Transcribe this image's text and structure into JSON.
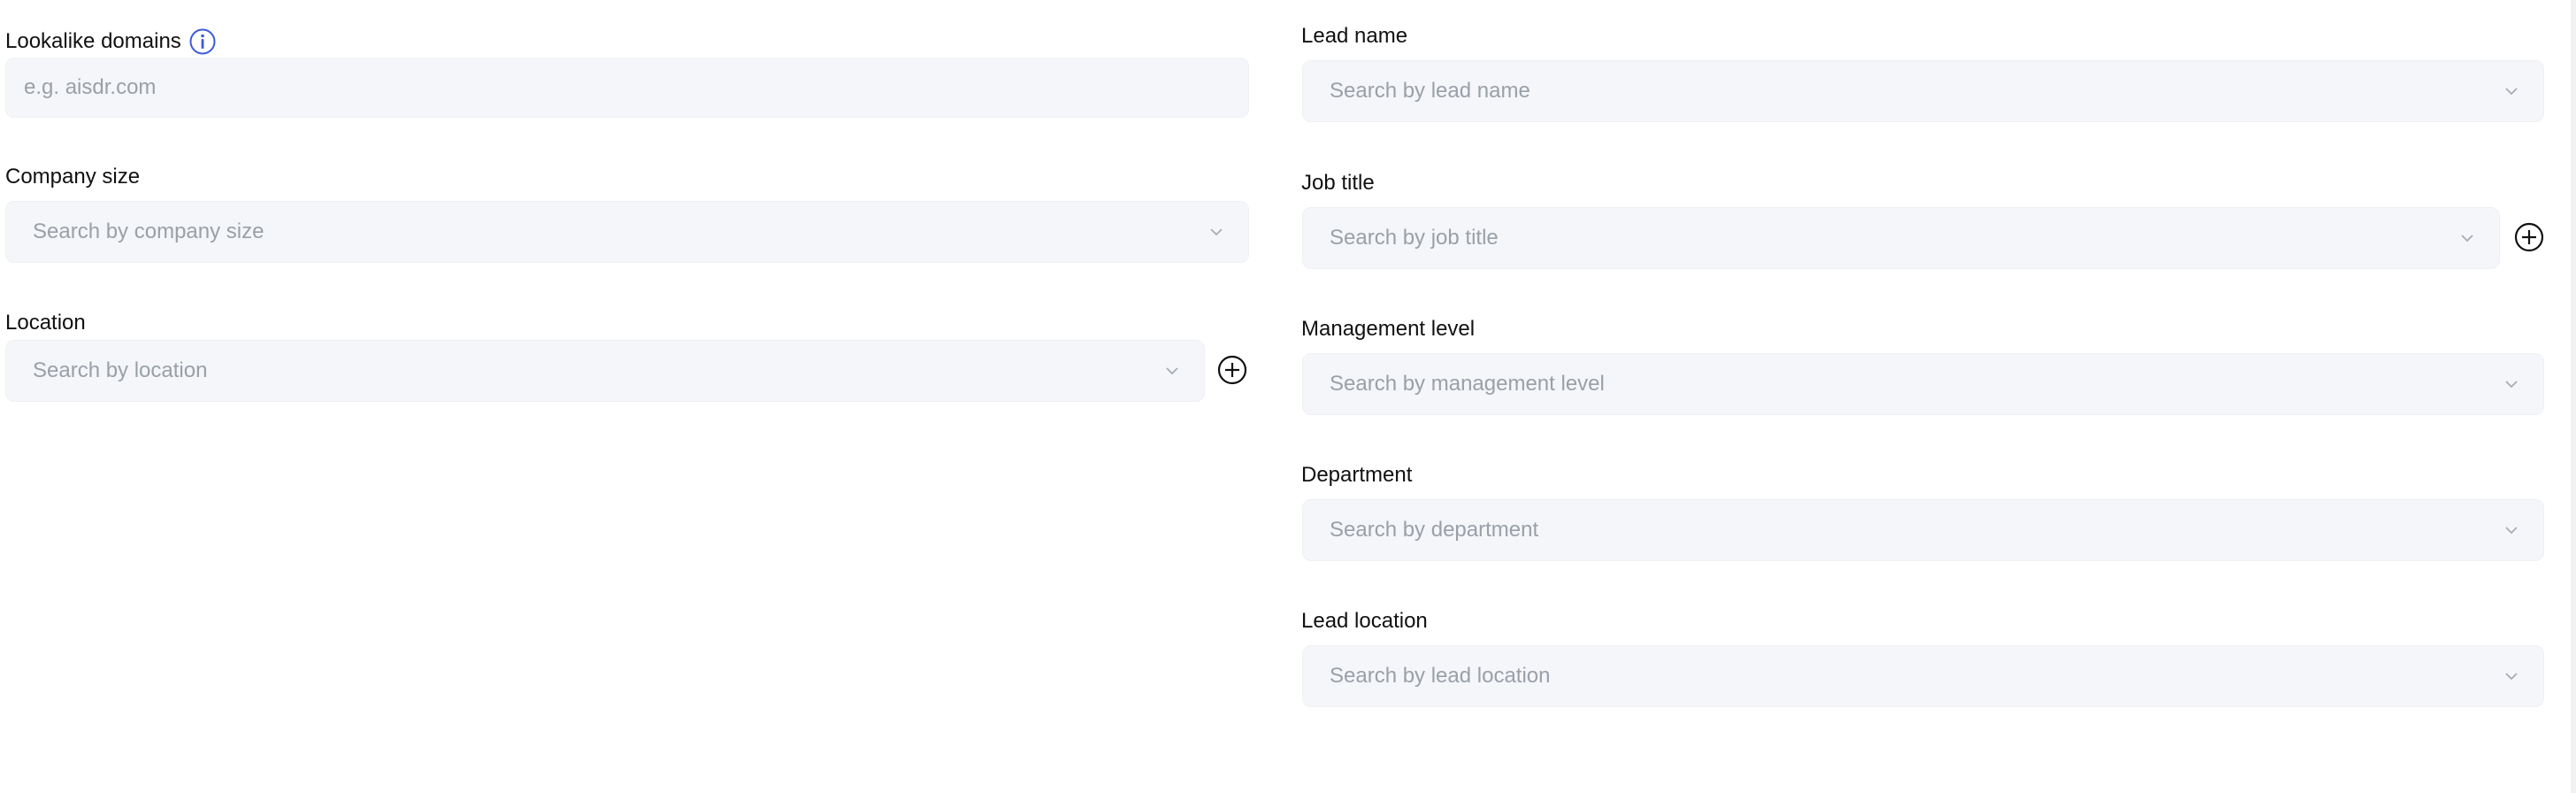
{
  "left_column": {
    "lookalike_domains": {
      "label": "Lookalike domains",
      "placeholder": "e.g. aisdr.com",
      "value": ""
    },
    "company_size": {
      "label": "Company size",
      "placeholder": "Search by company size"
    },
    "location": {
      "label": "Location",
      "placeholder": "Search by location"
    }
  },
  "right_column": {
    "lead_name": {
      "label": "Lead name",
      "placeholder": "Search by lead name"
    },
    "job_title": {
      "label": "Job title",
      "placeholder": "Search by job title"
    },
    "management_level": {
      "label": "Management level",
      "placeholder": "Search by management level"
    },
    "department": {
      "label": "Department",
      "placeholder": "Search by department"
    },
    "lead_location": {
      "label": "Lead location",
      "placeholder": "Search by lead location"
    }
  },
  "icons": {
    "info": "info-icon",
    "chevron": "chevron-down-icon",
    "add": "plus-circle-icon"
  },
  "colors": {
    "info_accent": "#3b5bdb",
    "field_background": "#f5f6f9",
    "placeholder_text": "#9aa0a8",
    "label_text": "#111111"
  }
}
